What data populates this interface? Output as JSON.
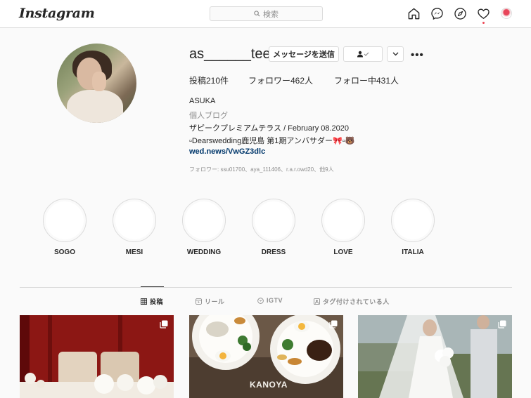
{
  "nav": {
    "logo": "Instagram",
    "search_placeholder": "検索",
    "icons": [
      "home-icon",
      "messenger-icon",
      "explore-icon",
      "activity-heart-icon",
      "profile-avatar"
    ]
  },
  "profile": {
    "username": "as______tee",
    "message_button": "メッセージを送信",
    "following_button_icon": "person-check-icon",
    "suggest_button_icon": "chevron-down-icon",
    "options_icon": "•••",
    "stats": {
      "posts": "投稿210件",
      "followers": "フォロワー462人",
      "following": "フォロー中431人"
    },
    "bio": {
      "name": "ASUKA",
      "category": "個人ブログ",
      "line1": "ザピークプレミアムテラス / February 08.2020",
      "line2": "▫︎Dearswedding鹿児島 第1期アンバサダー🎀▫︎🐻",
      "link": "wed.news/VwGZ3dlc"
    },
    "followed_by": "フォロワー: ssu01700、aya_111406、r.a.r.owd20、他9人"
  },
  "highlights": [
    "SOGO",
    "MESI",
    "WEDDING",
    "DRESS",
    "LOVE",
    "ITALIA"
  ],
  "tabs": [
    {
      "label": "投稿",
      "icon": "grid-icon",
      "active": true
    },
    {
      "label": "リール",
      "icon": "reels-icon",
      "active": false
    },
    {
      "label": "IGTV",
      "icon": "igtv-icon",
      "active": false
    },
    {
      "label": "タグ付けされている人",
      "icon": "tagged-icon",
      "active": false
    }
  ],
  "posts": [
    {
      "description_icon": "multi-post-icon"
    },
    {
      "description_icon": "multi-post-icon",
      "caption": "KANOYA"
    },
    {
      "description_icon": "multi-post-icon"
    }
  ],
  "colors": {
    "link": "#00376b",
    "secondary_text": "#8e8e8e",
    "border": "#dbdbdb",
    "notification": "#ed4956"
  }
}
